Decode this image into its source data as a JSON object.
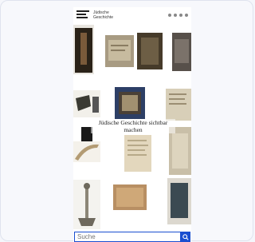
{
  "header": {
    "brand_line1": "Jüdische",
    "brand_line2": "Geschichte",
    "icons": [
      "menu-icon",
      "search-icon",
      "user-icon",
      "language-icon"
    ]
  },
  "hero": {
    "title": "Jüdische Geschichte sichtbar machen"
  },
  "tiles": [
    {
      "name": "object-candle",
      "color": "#2a2218"
    },
    {
      "name": "object-document",
      "color": "#a89b82"
    },
    {
      "name": "object-frame",
      "color": "#463b2a"
    },
    {
      "name": "object-box",
      "color": "#57504a"
    },
    {
      "name": "object-shoe",
      "color": "#3a3a32"
    },
    {
      "name": "object-photo",
      "color": "#2d3f66"
    },
    {
      "name": "object-manuscript",
      "color": "#d8cfb8"
    },
    {
      "name": "object-sign",
      "color": "#1a1a1a"
    },
    {
      "name": "object-horn",
      "color": "#b39b73"
    },
    {
      "name": "object-letter",
      "color": "#e3d7bd"
    },
    {
      "name": "object-poster",
      "color": "#c9bfa8"
    },
    {
      "name": "object-lamp",
      "color": "#8c8677"
    },
    {
      "name": "object-tablet",
      "color": "#b88f63"
    },
    {
      "name": "object-painting",
      "color": "#3b4a52"
    }
  ],
  "search": {
    "placeholder": "Suche",
    "button_icon": "search-icon"
  }
}
